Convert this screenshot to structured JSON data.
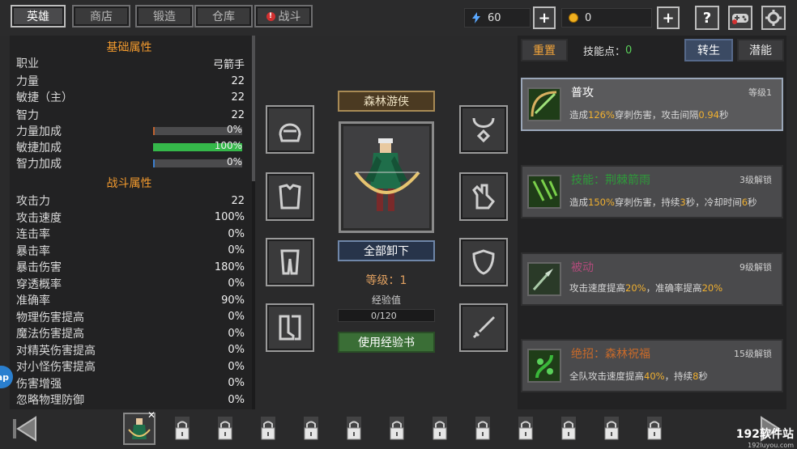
{
  "tabs": [
    {
      "label": "英雄",
      "active": true
    },
    {
      "label": "商店",
      "active": false
    },
    {
      "label": "锻造",
      "active": false
    },
    {
      "label": "仓库",
      "active": false
    },
    {
      "label": "战斗",
      "active": false,
      "warning": true
    }
  ],
  "resources": {
    "energy": "60",
    "gold": "0"
  },
  "buttons": {
    "plus": "+",
    "help": "?"
  },
  "basic": {
    "title": "基础属性",
    "rows": [
      {
        "label": "职业",
        "value": "弓箭手"
      },
      {
        "label": "力量",
        "value": "22"
      },
      {
        "label": "敏捷（主）",
        "value": "22"
      },
      {
        "label": "智力",
        "value": "22"
      }
    ],
    "bars": [
      {
        "label": "力量加成",
        "value": "0%",
        "level": 0.02,
        "color": "#c0622e"
      },
      {
        "label": "敏捷加成",
        "value": "100%",
        "level": 1.0,
        "color": "#35b84a"
      },
      {
        "label": "智力加成",
        "value": "0%",
        "level": 0.02,
        "color": "#3b7fcf"
      }
    ]
  },
  "combat": {
    "title": "战斗属性",
    "rows": [
      {
        "label": "攻击力",
        "value": "22"
      },
      {
        "label": "攻击速度",
        "value": "100%"
      },
      {
        "label": "连击率",
        "value": "0%"
      },
      {
        "label": "暴击率",
        "value": "0%"
      },
      {
        "label": "暴击伤害",
        "value": "180%"
      },
      {
        "label": "穿透概率",
        "value": "0%"
      },
      {
        "label": "准确率",
        "value": "90%"
      },
      {
        "label": "物理伤害提高",
        "value": "0%"
      },
      {
        "label": "魔法伤害提高",
        "value": "0%"
      },
      {
        "label": "对精英伤害提高",
        "value": "0%"
      },
      {
        "label": "对小怪伤害提高",
        "value": "0%"
      },
      {
        "label": "伤害增强",
        "value": "0%"
      },
      {
        "label": "忽略物理防御",
        "value": "0%"
      }
    ]
  },
  "hero": {
    "name": "森林游侠",
    "unequip_all": "全部卸下",
    "level": "等级：1",
    "exp_label": "经验值",
    "exp_text": "0/120",
    "exp_progress": 0,
    "use_exp_book": "使用经验书"
  },
  "right": {
    "reset": "重置",
    "skill_points_label": "技能点：",
    "skill_points": "0",
    "rebirth": "转生",
    "potential": "潜能"
  },
  "skills": [
    {
      "name": "普攻",
      "right": "等级1",
      "name_color": "#ffffff",
      "desc": [
        {
          "t": "造成"
        },
        {
          "t": "126%",
          "h": true
        },
        {
          "t": "穿刺伤害，攻击间隔"
        },
        {
          "t": "0.94",
          "h": true
        },
        {
          "t": "秒"
        }
      ]
    },
    {
      "name": "技能：荆棘箭雨",
      "right": "3级解锁",
      "name_color": "#2e9a3a",
      "desc": [
        {
          "t": "造成"
        },
        {
          "t": "150%",
          "h": true
        },
        {
          "t": "穿刺伤害，持续"
        },
        {
          "t": "3",
          "h": true
        },
        {
          "t": "秒，冷却时间"
        },
        {
          "t": "6",
          "h": true
        },
        {
          "t": "秒"
        }
      ]
    },
    {
      "name": "被动",
      "right": "9级解锁",
      "name_color": "#b04a7a",
      "desc": [
        {
          "t": "攻击速度提高"
        },
        {
          "t": "20%",
          "h": true
        },
        {
          "t": "，准确率提高"
        },
        {
          "t": "20%",
          "h": true
        }
      ]
    },
    {
      "name": "绝招：森林祝福",
      "right": "15级解锁",
      "name_color": "#c86a2a",
      "desc": [
        {
          "t": "全队攻击速度提高"
        },
        {
          "t": "40%",
          "h": true
        },
        {
          "t": "，持续"
        },
        {
          "t": "8",
          "h": true
        },
        {
          "t": "秒"
        }
      ]
    }
  ],
  "watermark": {
    "main": "192软件站",
    "sub": "192luyou.com"
  },
  "side_bubble": "ap"
}
